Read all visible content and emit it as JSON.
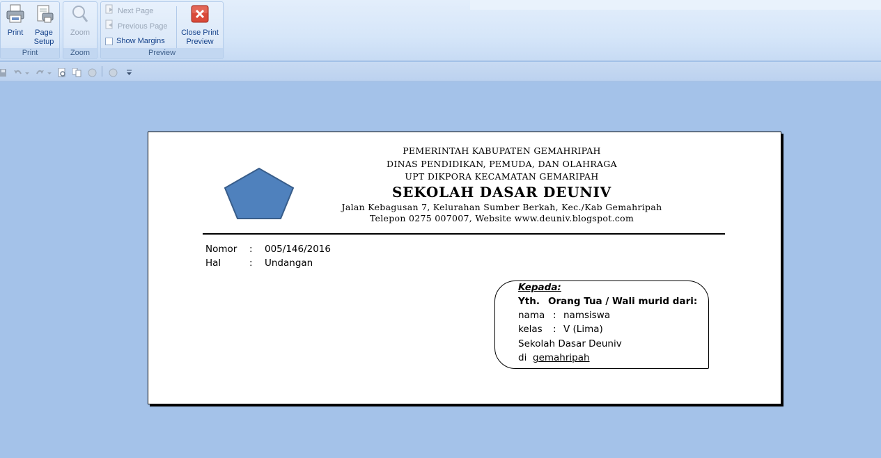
{
  "ribbon": {
    "print": {
      "print_label": "Print",
      "page_setup_label_1": "Page",
      "page_setup_label_2": "Setup",
      "group_label": "Print"
    },
    "zoom": {
      "zoom_label": "Zoom",
      "group_label": "Zoom"
    },
    "preview": {
      "next_page_label": "Next Page",
      "previous_page_label": "Previous Page",
      "show_margins_label": "Show Margins",
      "close_label_1": "Close Print",
      "close_label_2": "Preview",
      "group_label": "Preview"
    }
  },
  "letter": {
    "header": {
      "line1": "PEMERINTAH KABUPATEN GEMAHRIPAH",
      "line2": "DINAS PENDIDIKAN, PEMUDA, DAN OLAHRAGA",
      "line3": "UPT DIKPORA KECAMATAN GEMARIPAH",
      "school_name": "SEKOLAH DASAR DEUNIV",
      "address": "Jalan Kebagusan 7, Kelurahan Sumber Berkah, Kec./Kab Gemahripah",
      "contact": "Telepon 0275 007007, Website www.deuniv.blogspot.com"
    },
    "meta": {
      "nomor_label": "Nomor",
      "nomor_value": "005/146/2016",
      "hal_label": "Hal",
      "hal_value": "Undangan",
      "colon": ":"
    },
    "recipient": {
      "kepada": "Kepada:",
      "yth": "Yth.",
      "orang_tua": "Orang Tua / Wali murid dari:",
      "nama_label": "nama",
      "nama_value": "namsiswa",
      "kelas_label": "kelas",
      "kelas_value": "V (Lima)",
      "school": "Sekolah Dasar Deuniv",
      "di_label": "di",
      "di_value": "gemahripah",
      "colon": ":"
    }
  },
  "colors": {
    "workspace": "#a4c2e9",
    "logo_fill": "#4f81bd",
    "logo_stroke": "#385d8a",
    "ribbon_text": "#15428b"
  },
  "icons": {
    "print": "printer-icon",
    "page_setup": "page-setup-icon",
    "zoom": "magnifier-icon",
    "next_page": "next-page-icon",
    "previous_page": "previous-page-icon",
    "close": "close-x-icon"
  }
}
